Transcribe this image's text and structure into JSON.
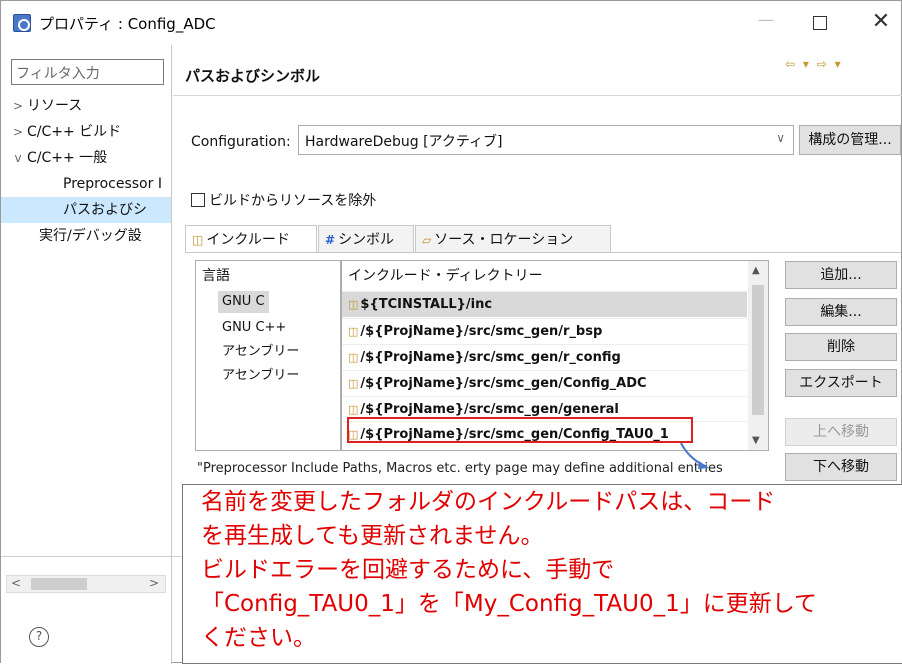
{
  "window": {
    "title": "プロパティ : Config_ADC",
    "minimize": "—",
    "close": "✕"
  },
  "left": {
    "filter_placeholder": "フィルタ入力",
    "tree": [
      {
        "label": "リソース",
        "arrow": ">",
        "indent": 1
      },
      {
        "label": "C/C++ ビルド",
        "arrow": ">",
        "indent": 1
      },
      {
        "label": "C/C++ 一般",
        "arrow": "v",
        "indent": 1
      },
      {
        "label": "Preprocessor I",
        "arrow": "",
        "indent": 3
      },
      {
        "label": "パスおよびシ",
        "arrow": "",
        "indent": 3,
        "selected": true
      },
      {
        "label": "実行/デバッグ設",
        "arrow": "",
        "indent": 2
      }
    ],
    "scroll_left": "<",
    "scroll_right": ">",
    "help": "?"
  },
  "main": {
    "page_title": "パスおよびシンボル",
    "config_label": "Configuration:",
    "config_value": "HardwareDebug  [アクティブ]",
    "manage_button": "構成の管理...",
    "exclude_label": "ビルドからリソースを除外",
    "tabs": [
      {
        "label": "インクルード",
        "icon": "include-icon",
        "active": true
      },
      {
        "label": "シンボル",
        "icon": "hash-icon",
        "active": false
      },
      {
        "label": "ソース・ロケーション",
        "icon": "folder-icon",
        "active": false
      }
    ],
    "languages_header": "言語",
    "languages": [
      "GNU C",
      "GNU C++",
      "アセンブリー",
      "アセンブリー"
    ],
    "dirs_header": "インクルード・ディレクトリー",
    "dirs": [
      "${TCINSTALL}/inc",
      "/${ProjName}/src/smc_gen/r_bsp",
      "/${ProjName}/src/smc_gen/r_config",
      "/${ProjName}/src/smc_gen/Config_ADC",
      "/${ProjName}/src/smc_gen/general",
      "/${ProjName}/src/smc_gen/Config_TAU0_1"
    ],
    "buttons": {
      "add": "追加...",
      "edit": "編集...",
      "delete": "削除",
      "export": "エクスポート",
      "up": "上へ移動",
      "down": "下へ移動"
    },
    "note": "\"Preprocessor Include Paths, Macros etc.  erty page may define additional entries"
  },
  "callout": {
    "text": "名前を変更したフォルダのインクルードパスは、コード\nを再生成しても更新されません。\nビルドエラーを回避するために、手動で\n「Config_TAU0_1」を「My_Config_TAU0_1」に更新して\nください。"
  },
  "colors": {
    "accent_red": "#e00000",
    "selection": "#cce8ff"
  }
}
